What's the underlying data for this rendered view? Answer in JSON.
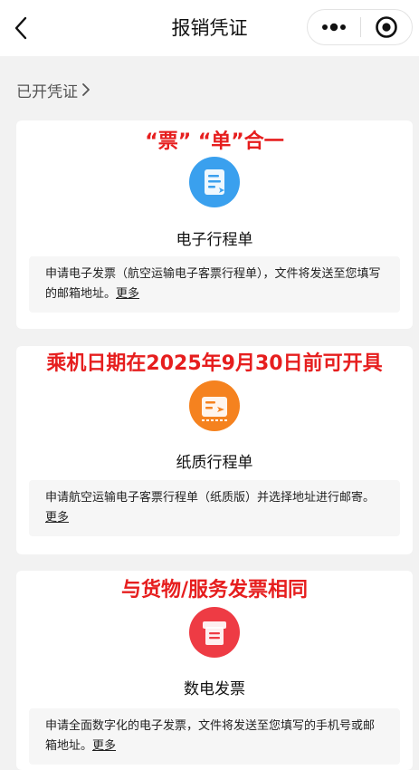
{
  "nav": {
    "title": "报销凭证"
  },
  "opened_link": "已开凭证",
  "cards": [
    {
      "banner": "“票” “单”合一",
      "title": "电子行程单",
      "desc": "申请电子发票（航空运输电子客票行程单），文件将发送至您填写的邮箱地址。",
      "more": "更多",
      "icon_color": "#3aa0ee"
    },
    {
      "banner": "乘机日期在2025年9月30日前可开具",
      "title": "纸质行程单",
      "desc": "申请航空运输电子客票行程单（纸质版）并选择地址进行邮寄。",
      "more": "更多",
      "icon_color": "#f5821f"
    },
    {
      "banner": "与货物/服务发票相同",
      "title": "数电发票",
      "desc": "申请全面数字化的电子发票，文件将发送至您填写的手机号或邮箱地址。",
      "more": "更多",
      "icon_color": "#ee3b44"
    }
  ],
  "colors": {
    "banner_red": "#e61e1e",
    "background": "#f2f2f2"
  }
}
